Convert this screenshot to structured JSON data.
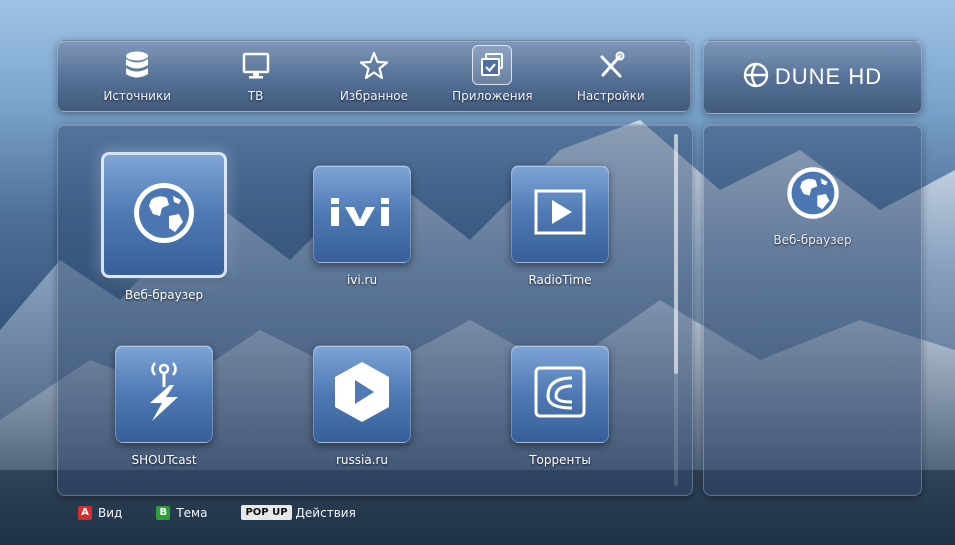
{
  "brand": {
    "name": "DUNE HD"
  },
  "menu": {
    "items": [
      {
        "label": "Источники",
        "icon": "database-icon"
      },
      {
        "label": "ТВ",
        "icon": "monitor-icon"
      },
      {
        "label": "Избранное",
        "icon": "star-icon"
      },
      {
        "label": "Приложения",
        "icon": "applications-icon",
        "active": true
      },
      {
        "label": "Настройки",
        "icon": "tools-icon"
      }
    ]
  },
  "apps": [
    {
      "label": "Веб-браузер",
      "icon": "globe-icon",
      "selected": true
    },
    {
      "label": "ivi.ru",
      "icon": "ivi-logo-icon"
    },
    {
      "label": "RadioTime",
      "icon": "play-icon"
    },
    {
      "label": "SHOUTcast",
      "icon": "antenna-icon"
    },
    {
      "label": "russia.ru",
      "icon": "hexagon-play-icon"
    },
    {
      "label": "Торренты",
      "icon": "wave-icon"
    }
  ],
  "side": {
    "label": "Веб-браузер",
    "icon": "globe-icon"
  },
  "footer": {
    "red": {
      "key": "A",
      "label": "Вид",
      "color": "#d32f2f"
    },
    "green": {
      "key": "B",
      "label": "Тема",
      "color": "#2e9e3a"
    },
    "popup": {
      "key": "POP UP",
      "label": "Действия"
    }
  },
  "colors": {
    "accent": "#4f79b4"
  }
}
